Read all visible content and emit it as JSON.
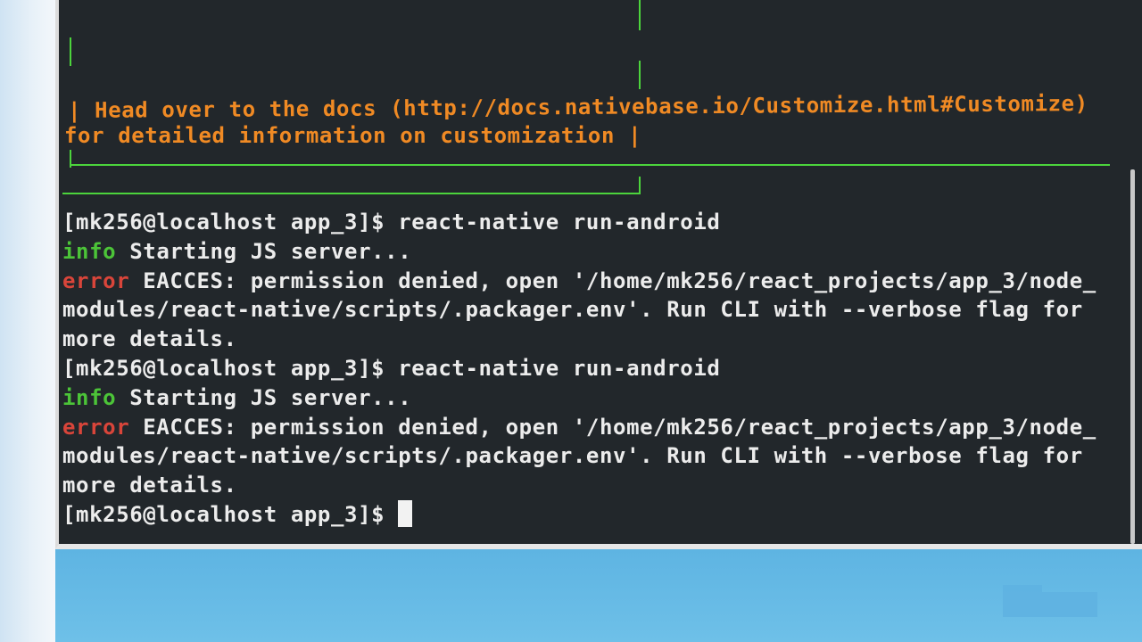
{
  "terminal": {
    "banner": {
      "docs_line_1": "| Head over to the docs (http://docs.nativebase.io/Customize.html#Customize)",
      "docs_line_2": "for detailed information on customization |"
    },
    "lines": [
      {
        "type": "prompt",
        "prompt": "[mk256@localhost app_3]$ ",
        "command": "react-native run-android"
      },
      {
        "type": "info",
        "tag": "info",
        "text": " Starting JS server..."
      },
      {
        "type": "error",
        "tag": "error",
        "text": " EACCES: permission denied, open '/home/mk256/react_projects/app_3/node_"
      },
      {
        "type": "plain",
        "text": "modules/react-native/scripts/.packager.env'. Run CLI with --verbose flag for"
      },
      {
        "type": "plain",
        "text": "more details."
      },
      {
        "type": "prompt",
        "prompt": "[mk256@localhost app_3]$ ",
        "command": "react-native run-android"
      },
      {
        "type": "info",
        "tag": "info",
        "text": " Starting JS server..."
      },
      {
        "type": "error",
        "tag": "error",
        "text": " EACCES: permission denied, open '/home/mk256/react_projects/app_3/node_"
      },
      {
        "type": "plain",
        "text": "modules/react-native/scripts/.packager.env'. Run CLI with --verbose flag for"
      },
      {
        "type": "plain",
        "text": "more details."
      }
    ],
    "current_prompt": "[mk256@localhost app_3]$ "
  },
  "colors": {
    "background": "#22272b",
    "banner_text": "#f08a24",
    "info_tag": "#4cc438",
    "error_tag": "#d9453a",
    "border": "#4cd43c"
  }
}
